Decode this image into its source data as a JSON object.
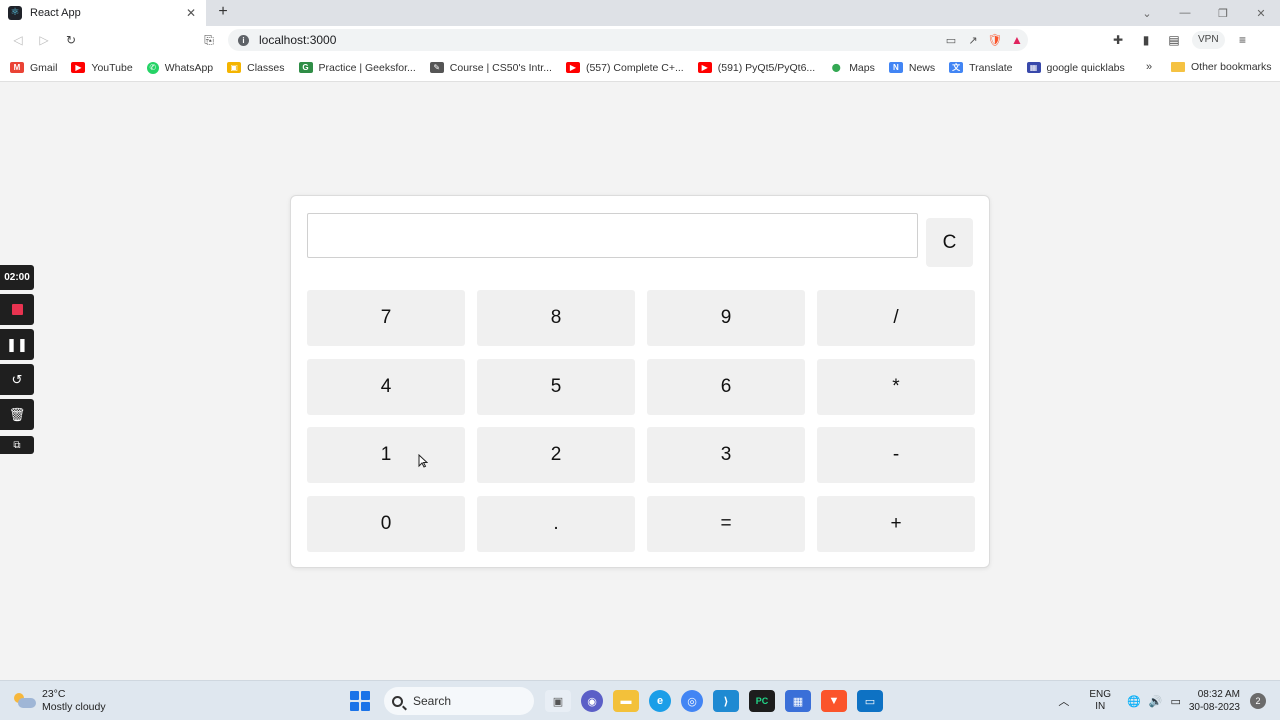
{
  "browser": {
    "tab_title": "React App",
    "tab_close": "✕",
    "new_tab": "+",
    "url": "localhost:3000",
    "vpn_label": "VPN",
    "bookmarks": [
      {
        "label": "Gmail",
        "icon": "M",
        "color": "#ea4335"
      },
      {
        "label": "YouTube",
        "icon": "▶",
        "color": "#ff0000"
      },
      {
        "label": "WhatsApp",
        "icon": "✆",
        "color": "#25d366"
      },
      {
        "label": "Classes",
        "icon": "▣",
        "color": "#f4b400"
      },
      {
        "label": "Practice | Geeksfor...",
        "icon": "G",
        "color": "#2f8d46"
      },
      {
        "label": "Course | CS50's Intr...",
        "icon": "✎",
        "color": "#555555"
      },
      {
        "label": "(557) Complete C+...",
        "icon": "▶",
        "color": "#ff0000"
      },
      {
        "label": "(591) PyQt5/PyQt6...",
        "icon": "▶",
        "color": "#ff0000"
      },
      {
        "label": "Maps",
        "icon": "⬤",
        "color": "#34a853"
      },
      {
        "label": "News",
        "icon": "N",
        "color": "#4285f4"
      },
      {
        "label": "Translate",
        "icon": "文",
        "color": "#4285f4"
      },
      {
        "label": "google quicklabs",
        "icon": "▦",
        "color": "#3949ab"
      }
    ],
    "bookmarks_overflow": "»",
    "other_bookmarks": "Other bookmarks"
  },
  "recorder": {
    "time": "02:00"
  },
  "calculator": {
    "display_value": "",
    "clear_label": "C",
    "keys": [
      "7",
      "8",
      "9",
      "/",
      "4",
      "5",
      "6",
      "*",
      "1",
      "2",
      "3",
      "-",
      "0",
      ".",
      "=",
      "+"
    ]
  },
  "taskbar": {
    "temperature": "23°C",
    "weather": "Mostly cloudy",
    "search_label": "Search",
    "lang_top": "ENG",
    "lang_bottom": "IN",
    "time": "08:32 AM",
    "date": "30-08-2023",
    "notifications": "2"
  }
}
